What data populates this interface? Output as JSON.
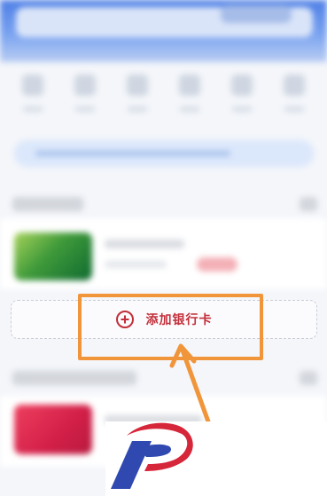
{
  "add_bank_card": {
    "label": "添加银行卡",
    "icon": "plus-circle-icon"
  },
  "colors": {
    "accent_red": "#c22f3a",
    "highlight_orange": "#f0953a",
    "banner_blue": "#4e7fe6"
  },
  "logo": {
    "icon": "stylized-p-logo"
  }
}
